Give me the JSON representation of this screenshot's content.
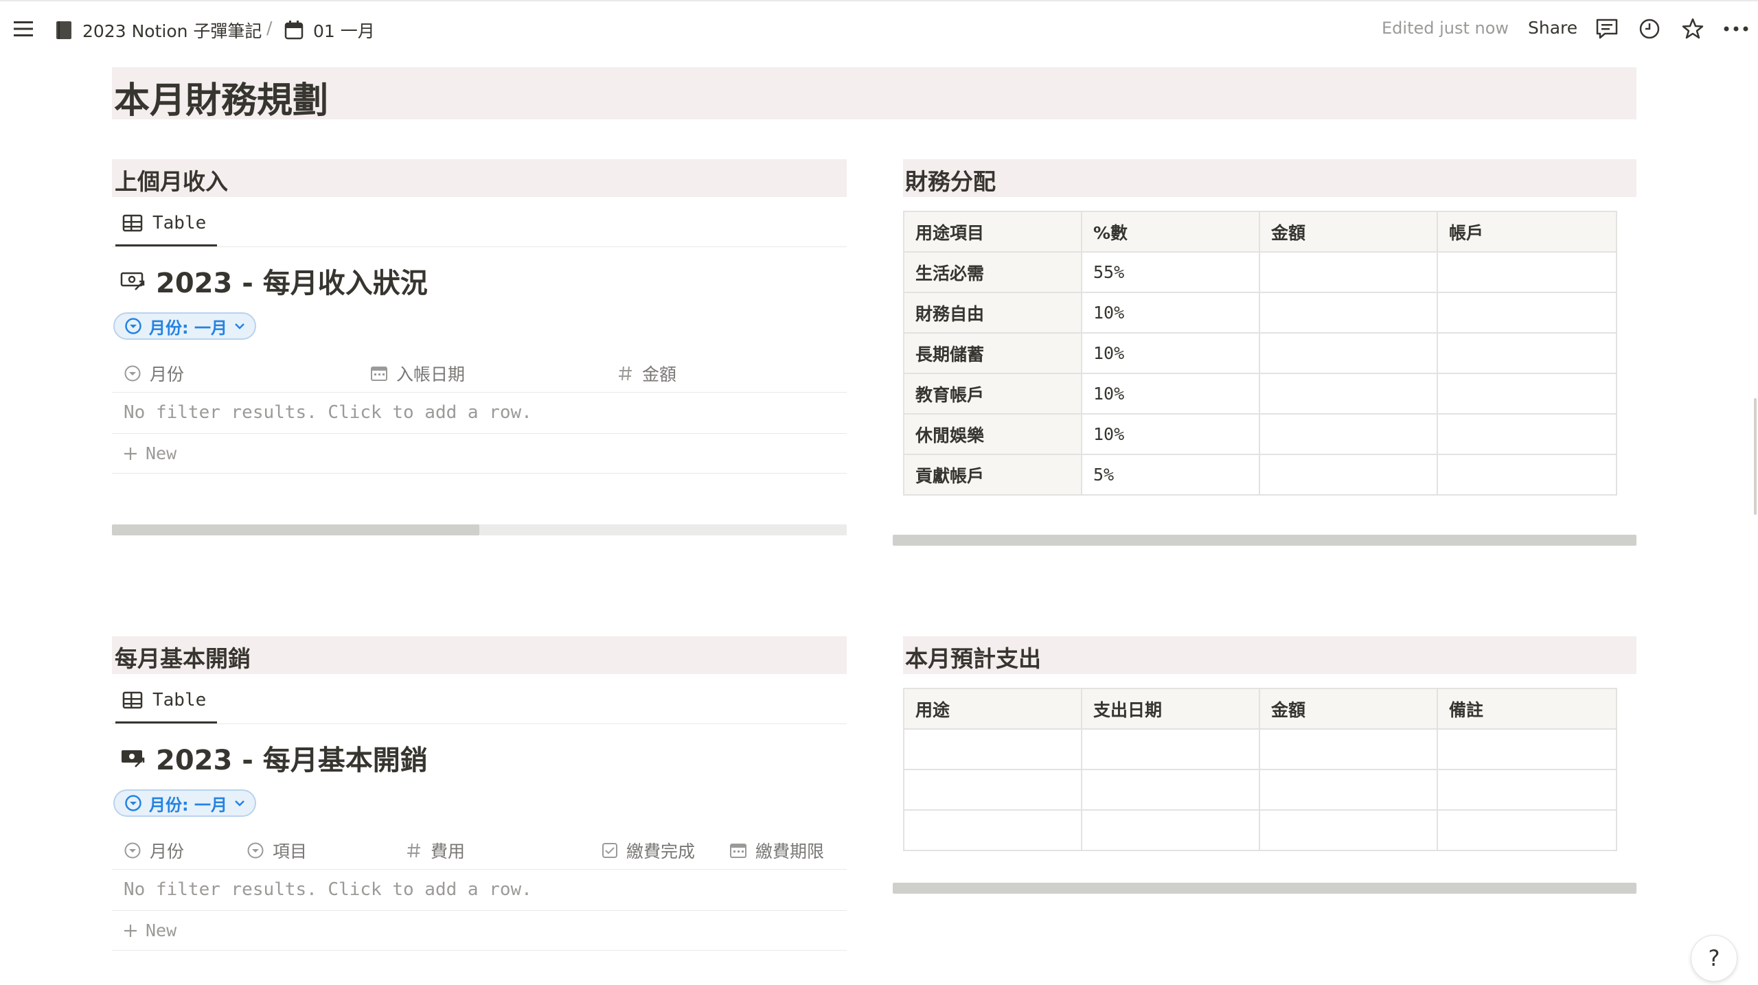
{
  "breadcrumb": {
    "workspace_label": "2023 Notion 子彈筆記",
    "separator": "/",
    "page_label": "01 一月"
  },
  "topbar": {
    "edited": "Edited just now",
    "share": "Share"
  },
  "page": {
    "heading": "本月財務規劃"
  },
  "income_section": {
    "heading": "上個月收入",
    "tab_label": "Table",
    "db_title": "2023 - 每月收入狀況",
    "filter_label": "月份: 一月",
    "columns": [
      "月份",
      "入帳日期",
      "金額"
    ],
    "empty_text": "No filter results. Click to add a row.",
    "new_label": "New",
    "scroll_position": 0.5
  },
  "allocation_section": {
    "heading": "財務分配",
    "headers": [
      "用途項目",
      "%數",
      "金額",
      "帳戶"
    ],
    "rows": [
      {
        "item": "生活必需",
        "percent": "55%",
        "amount": "",
        "account": ""
      },
      {
        "item": "財務自由",
        "percent": "10%",
        "amount": "",
        "account": ""
      },
      {
        "item": "長期儲蓄",
        "percent": "10%",
        "amount": "",
        "account": ""
      },
      {
        "item": "教育帳戶",
        "percent": "10%",
        "amount": "",
        "account": ""
      },
      {
        "item": "休閒娛樂",
        "percent": "10%",
        "amount": "",
        "account": ""
      },
      {
        "item": "貢獻帳戶",
        "percent": "5%",
        "amount": "",
        "account": ""
      }
    ]
  },
  "expense_section": {
    "heading": "每月基本開銷",
    "tab_label": "Table",
    "db_title": "2023 - 每月基本開銷",
    "filter_label": "月份: 一月",
    "columns": [
      "月份",
      "項目",
      "費用",
      "繳費完成",
      "繳費期限"
    ],
    "empty_text": "No filter results. Click to add a row.",
    "new_label": "New"
  },
  "planned_section": {
    "heading": "本月預計支出",
    "headers": [
      "用途",
      "支出日期",
      "金額",
      "備註"
    ],
    "rows": [
      [
        "",
        "",
        "",
        ""
      ],
      [
        "",
        "",
        "",
        ""
      ],
      [
        "",
        "",
        "",
        ""
      ]
    ]
  },
  "help_label": "?",
  "colors": {
    "text": "#37352f",
    "muted": "#9b9a97",
    "heading_bg": "#f4eeee",
    "filter_blue": "#2383e2",
    "table_header_bg": "#f7f6f3"
  },
  "icons": [
    "menu-icon",
    "notebook-icon",
    "calendar-icon",
    "comment-icon",
    "clock-icon",
    "star-icon",
    "more-icon",
    "table-icon",
    "money-icon",
    "select-icon",
    "date-icon",
    "number-icon",
    "checkbox-icon",
    "plus-icon",
    "chevron-down-icon"
  ]
}
